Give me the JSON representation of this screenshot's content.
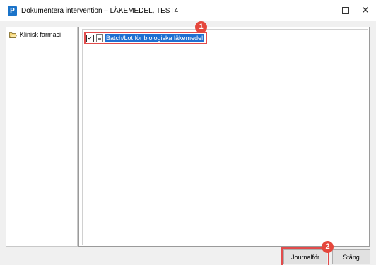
{
  "window": {
    "app_icon_letter": "P",
    "title": "Dokumentera intervention – LÄKEMEDEL, TEST4",
    "close_glyph": "✕"
  },
  "tree": {
    "root_label": "Klinisk farmaci"
  },
  "list": {
    "item_checked_mark": "✔",
    "item_label": "Batch/Lot för biologiska läkemedel"
  },
  "annotations": {
    "badge_1": "1",
    "badge_2": "2"
  },
  "buttons": {
    "journal_label": "Journalför",
    "close_label": "Stäng"
  },
  "colors": {
    "selection": "#1f6fd1",
    "annotation_red": "#e5473c",
    "app_icon": "#1a73c9"
  }
}
